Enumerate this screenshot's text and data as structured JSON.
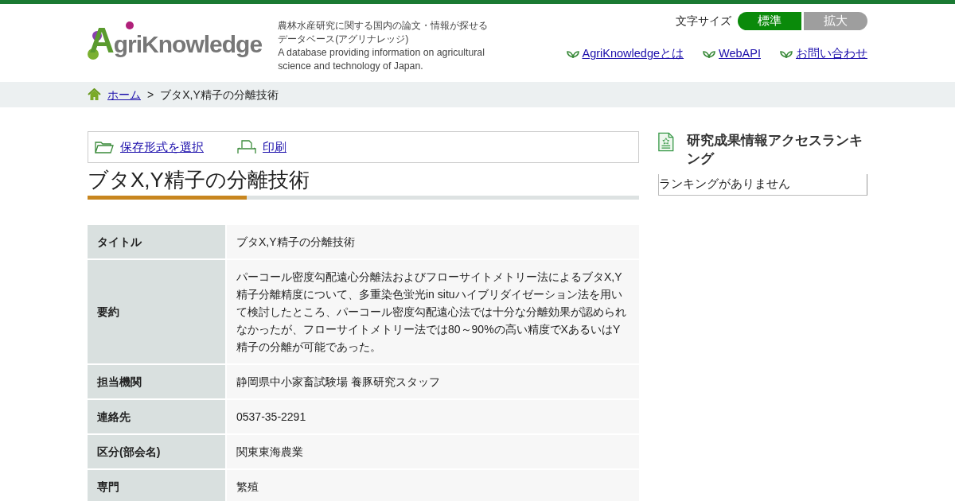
{
  "header": {
    "logo": {
      "initial": "A",
      "rest": "griKnowledge"
    },
    "tagline_ja": "農林水産研究に関する国内の論文・情報が探せるデータベース(アグリナレッジ)",
    "tagline_en": "A database providing information on agricultural science and technology of Japan.",
    "font_size": {
      "label": "文字サイズ",
      "options": [
        {
          "label": "標準",
          "selected": true
        },
        {
          "label": "拡大",
          "selected": false
        }
      ]
    },
    "links": [
      "AgriKnowledgeとは",
      "WebAPI",
      "お問い合わせ"
    ]
  },
  "breadcrumb": {
    "home": "ホーム",
    "separator": ">",
    "current": "ブタX,Y精子の分離技術"
  },
  "actions": [
    {
      "kind": "save",
      "label": "保存形式を選択"
    },
    {
      "kind": "print",
      "label": "印刷"
    }
  ],
  "title": "ブタX,Y精子の分離技術",
  "details": [
    {
      "label": "タイトル",
      "value": "ブタX,Y精子の分離技術"
    },
    {
      "label": "要約",
      "value": "パーコール密度勾配遠心分離法およびフローサイトメトリー法によるブタX,Y精子分離精度について、多重染色蛍光in situハイブリダイゼーション法を用いて検討したところ、パーコール密度勾配遠心法では十分な分離効果が認められなかったが、フローサイトメトリー法では80～90%の高い精度でXあるいはY精子の分離が可能であった。"
    },
    {
      "label": "担当機関",
      "value": "静岡県中小家畜試験場 養豚研究スタッフ"
    },
    {
      "label": "連絡先",
      "value": "0537-35-2291"
    },
    {
      "label": "区分(部会名)",
      "value": "関東東海農業"
    },
    {
      "label": "専門",
      "value": "繁殖"
    }
  ],
  "sidebar": {
    "title": "研究成果情報アクセスランキング",
    "empty": "ランキングがありません"
  }
}
